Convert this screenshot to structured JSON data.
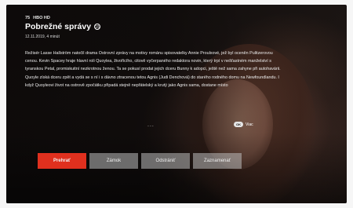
{
  "program": {
    "channel_number": "75",
    "channel_name": "HBO HD",
    "title": "Pobrežné správy",
    "rating_symbol": "15",
    "date_duration": "12.11.2019, 4 minút",
    "description": "Režisér Lasse Hallström natočil drama Ostrovní zprávy na motivy románu spisovatelky Annie Proulxové, jež byl oceněn Pulitzerovou cenou. Kevin Spacey hraje hlavní roli Quoylea, živořícího, citově vyčerpaného redaktora novin, který trpí v nešťastném manželství s tyranskou Petal, promiskuitní nezkrotnou ženou. Ta se pokusí prodat jejich dceru Bunny k adopci, ještě než sama zahyne při autohavárii. Quoyle získá dceru zpět a vydá se s ní i s dávno ztracenou tetou Agnis (Judi Denchová) do starého rodného domu na Newfoundlandu. I když Quoyleovi život na ostrově zpočátku připadá stejně nepřátelský a krutý jako Agnis sama, dostane místo",
    "ellipsis": "...",
    "more_badge": "OK",
    "more_label": "Viac"
  },
  "actions": {
    "play": "Prehrať",
    "lock": "Zámok",
    "remove": "Odstrániť",
    "record": "Zaznamenať"
  },
  "colors": {
    "accent_red": "#e0301e",
    "button_gray": "#bebebe"
  }
}
